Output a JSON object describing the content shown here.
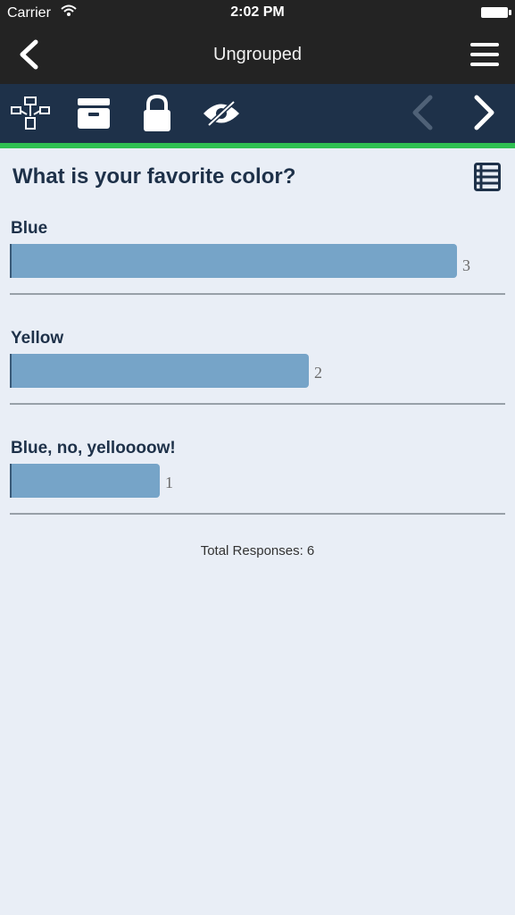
{
  "status": {
    "carrier": "Carrier",
    "time": "2:02 PM"
  },
  "nav": {
    "title": "Ungrouped"
  },
  "question": "What is your favorite color?",
  "answers": [
    {
      "label": "Blue",
      "count": "3",
      "value": 3
    },
    {
      "label": "Yellow",
      "count": "2",
      "value": 2
    },
    {
      "label": "Blue, no, yelloooow!",
      "count": "1",
      "value": 1
    }
  ],
  "total": "Total Responses: 6",
  "colors": {
    "navbar": "#232323",
    "toolbar": "#1e3149",
    "accent": "#2fc051",
    "bar": "#76a4c8",
    "background": "#e9eef6"
  },
  "icons": {
    "toolbar": [
      "flowchart-icon",
      "archive-icon",
      "lock-icon",
      "eye-off-icon",
      "chevron-left-icon",
      "chevron-right-icon"
    ],
    "nav": [
      "back-chevron-icon",
      "hamburger-menu-icon"
    ],
    "question": "list-icon"
  }
}
